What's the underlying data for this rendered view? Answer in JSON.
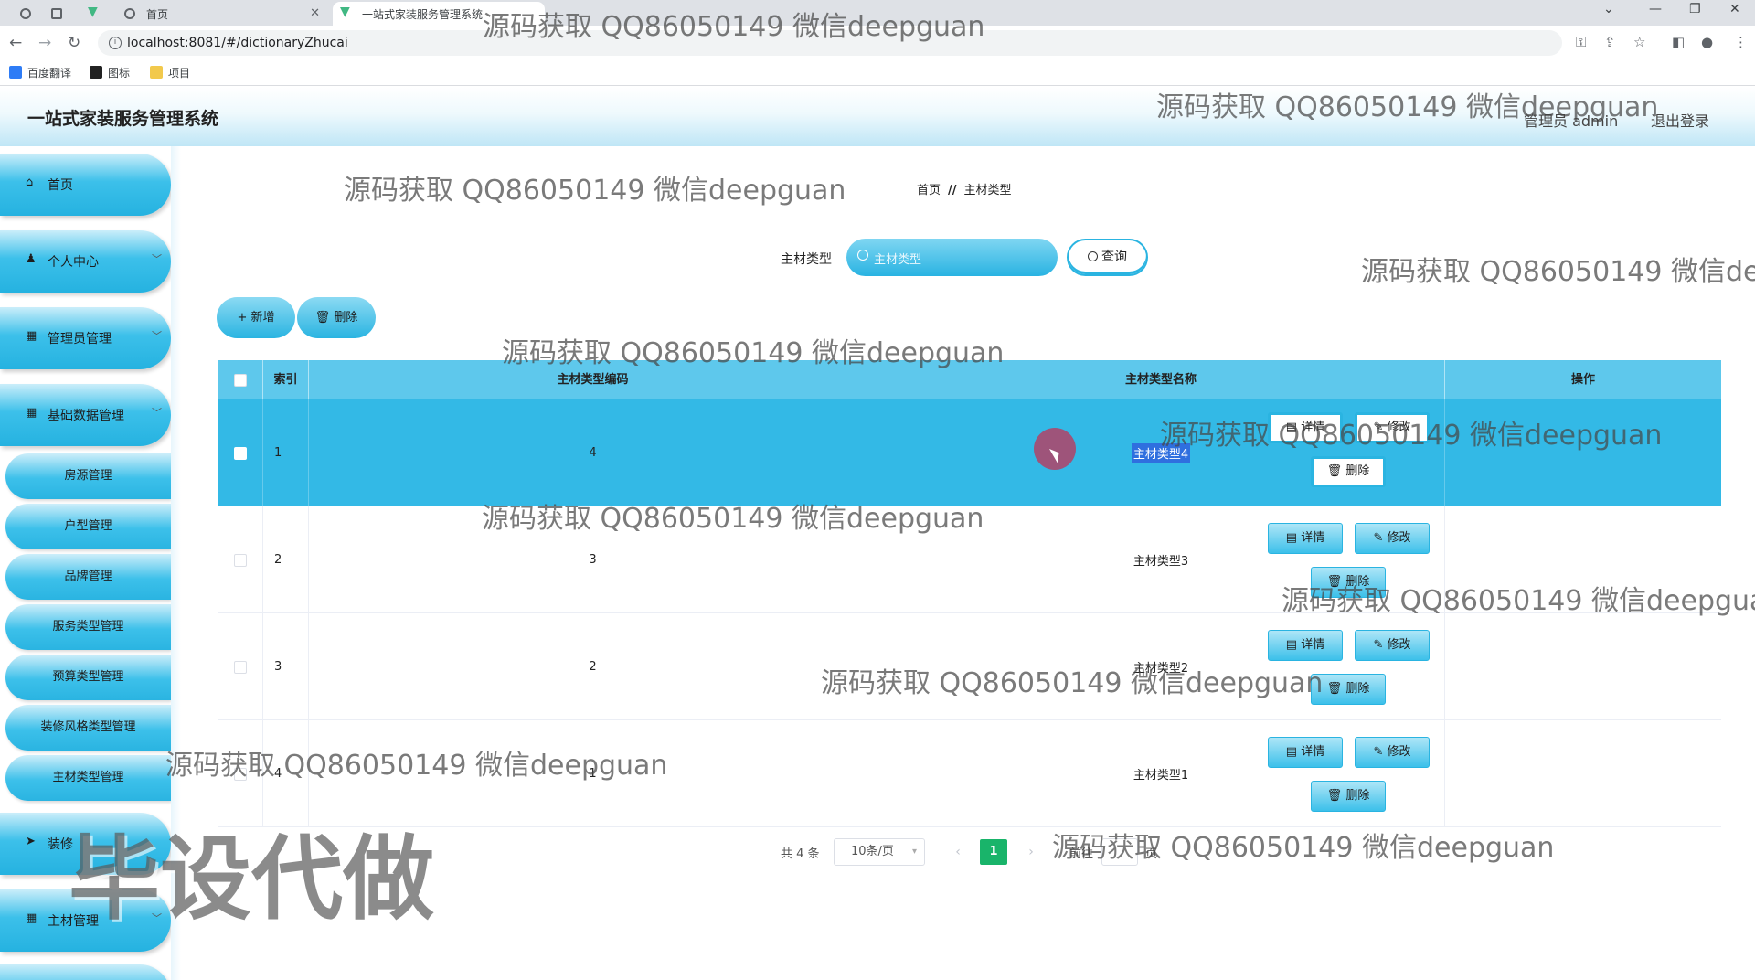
{
  "browser": {
    "tabs": [
      {
        "label": "首页",
        "icon": "globe-icon"
      },
      {
        "label": "一站式家装服务管理系统",
        "icon": "vue-logo-icon"
      }
    ],
    "url": "localhost:8081/#/dictionaryZhucai",
    "bookmarks": [
      {
        "label": "百度翻译",
        "icon": "translate-icon",
        "color": "#2e7cf6"
      },
      {
        "label": "图标",
        "icon": "image-icon",
        "color": "#222222"
      },
      {
        "label": "项目",
        "icon": "folder-icon",
        "color": "#f2c94c"
      }
    ]
  },
  "header": {
    "title": "一站式家装服务管理系统",
    "user": "管理员 admin",
    "logout": "退出登录"
  },
  "sidebar": {
    "menus": [
      {
        "label": "首页",
        "icon": "home-icon"
      },
      {
        "label": "个人中心",
        "icon": "user-icon"
      },
      {
        "label": "管理员管理",
        "icon": "grid-icon"
      },
      {
        "label": "基础数据管理",
        "icon": "grid-icon"
      }
    ],
    "submenus": [
      "房源管理",
      "户型管理",
      "品牌管理",
      "服务类型管理",
      "预算类型管理",
      "装修风格类型管理",
      "主材类型管理"
    ],
    "menus_lower": [
      {
        "label": "装修",
        "icon": "send-icon"
      },
      {
        "label": "主材管理",
        "icon": "grid-icon"
      }
    ]
  },
  "breadcrumb": {
    "home": "首页",
    "separator": "//",
    "current": "主材类型"
  },
  "search": {
    "label": "主材类型",
    "placeholder": "主材类型",
    "button": "查询"
  },
  "actions": {
    "add": "+ 新增",
    "delete": "删除"
  },
  "table": {
    "columns": [
      "索引",
      "主材类型编码",
      "主材类型名称",
      "操作"
    ],
    "rows": [
      {
        "index": "1",
        "code": "4",
        "name": "主材类型4"
      },
      {
        "index": "2",
        "code": "3",
        "name": "主材类型3"
      },
      {
        "index": "3",
        "code": "2",
        "name": "主材类型2"
      },
      {
        "index": "4",
        "code": "1",
        "name": "主材类型1"
      }
    ],
    "selected_row": 0,
    "buttons": {
      "detail": "详情",
      "edit": "修改",
      "delete": "删除"
    }
  },
  "pagination": {
    "total": "共 4 条",
    "page_size": "10条/页",
    "current": "1",
    "goto": "前往",
    "goto_unit": "页"
  },
  "watermarks": {
    "text": "源码获取 QQ86050149 微信deepguan",
    "big": "毕设代做"
  },
  "colors": {
    "accent": "#2ab4e1",
    "header_row": "#5ec8ec",
    "selected_row": "#33b9e6",
    "page_active": "#19b46a"
  }
}
